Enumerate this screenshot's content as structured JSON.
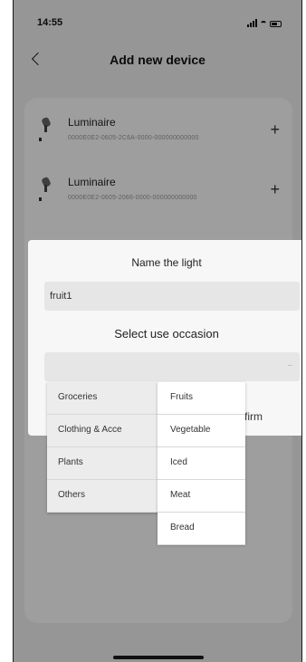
{
  "status_bar": {
    "time": "14:55"
  },
  "header": {
    "title": "Add new device"
  },
  "devices": [
    {
      "name": "Luminaire",
      "uuid": "0000E0E2-0605-2C6A-0000-000000000000"
    },
    {
      "name": "Luminaire",
      "uuid": "0000E0E2-0605-2066-0000-000000000000"
    }
  ],
  "dialog": {
    "title": "Name the light",
    "name_value": "fruit1",
    "occasion_label": "Select use occasion",
    "occasion_value": "",
    "confirm_label": "firm"
  },
  "dropdown": {
    "categories": [
      "Groceries",
      "Clothing & Acce",
      "Plants",
      "Others"
    ],
    "options": [
      "Fruits",
      "Vegetable",
      "Iced",
      "Meat",
      "Bread"
    ]
  }
}
